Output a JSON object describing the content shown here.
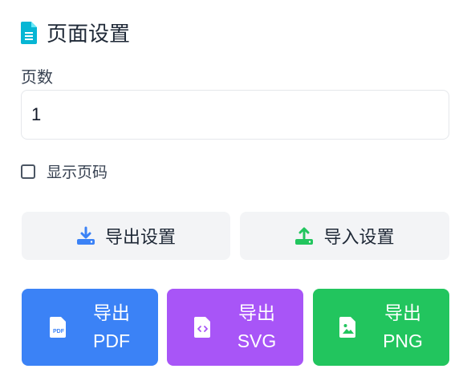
{
  "page_settings": {
    "title": "页面设置",
    "page_count_label": "页数",
    "page_count_value": "1",
    "show_page_number_label": "显示页码",
    "show_page_number_checked": false
  },
  "settings_actions": {
    "export_label": "导出设置",
    "import_label": "导入设置"
  },
  "export_buttons": {
    "pdf": {
      "line1": "导出",
      "line2": "PDF"
    },
    "svg": {
      "line1": "导出",
      "line2": "SVG"
    },
    "png": {
      "line1": "导出",
      "line2": "PNG"
    }
  },
  "colors": {
    "title_icon": "#06b6d4",
    "export_settings_icon": "#3b82f6",
    "import_settings_icon": "#22c55e",
    "pdf": "#3b82f6",
    "svg": "#a855f7",
    "png": "#22c55e"
  },
  "icons": {
    "title": "file-text-icon",
    "export_settings": "download-icon",
    "import_settings": "upload-icon",
    "pdf": "file-pdf-icon",
    "svg": "file-code-icon",
    "png": "file-image-icon"
  }
}
